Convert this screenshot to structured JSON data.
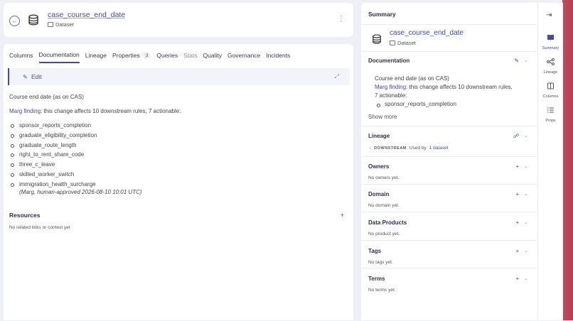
{
  "header": {
    "title": "case_course_end_date",
    "subtype": "Dataset"
  },
  "tabs": [
    {
      "label": "Columns"
    },
    {
      "label": "Documentation"
    },
    {
      "label": "Lineage"
    },
    {
      "label": "Properties",
      "count": "3"
    },
    {
      "label": "Queries"
    },
    {
      "label": "Stats"
    },
    {
      "label": "Quality"
    },
    {
      "label": "Governance"
    },
    {
      "label": "Incidents"
    }
  ],
  "documentation": {
    "edit_label": "Edit",
    "description": "Course end date (as on CAS)",
    "finding_prefix": "Marg finding:",
    "finding_text": " this change affects 10 downstream rules, 7 actionable:",
    "rules": [
      "sponsor_reports_completion",
      "graduate_eligibility_completion",
      "graduate_route_length",
      "right_to_rent_share_code",
      "three_c_leave",
      "skilled_worker_switch",
      "immigration_health_surcharge"
    ],
    "approval": "(Marg, human-approved 2026-08-10 10:01 UTC)"
  },
  "resources": {
    "title": "Resources",
    "empty": "No related links or context yet"
  },
  "summary": {
    "panel_title": "Summary",
    "name": "case_course_end_date",
    "type": "Dataset",
    "documentation": {
      "title": "Documentation",
      "line1": "Course end date (as on CAS)",
      "finding_prefix": "Marg finding:",
      "finding_text": " this change affects 10 downstream rules,",
      "line3": "7 actionable:",
      "bullet": "sponsor_reports_completion",
      "show_more": "Show more"
    },
    "lineage": {
      "title": "Lineage",
      "downstream": "DOWNSTREAM",
      "used_by": "Used by",
      "link": "1 dataset"
    },
    "owners": {
      "title": "Owners",
      "empty": "No owners yet."
    },
    "domain": {
      "title": "Domain",
      "empty": "No domain yet."
    },
    "data_products": {
      "title": "Data Products",
      "empty": "No product yet."
    },
    "tags": {
      "title": "Tags",
      "empty": "No tags yet."
    },
    "terms": {
      "title": "Terms",
      "empty": "No terms yet."
    }
  },
  "rail": {
    "items": [
      {
        "label": "Summary",
        "icon": "book-icon"
      },
      {
        "label": "Lineage",
        "icon": "lineage-icon"
      },
      {
        "label": "Columns",
        "icon": "columns-icon"
      },
      {
        "label": "Props",
        "icon": "list-icon"
      }
    ]
  }
}
